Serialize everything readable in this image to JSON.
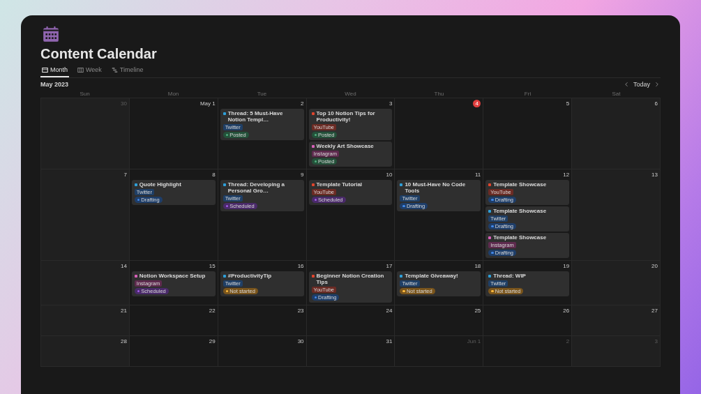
{
  "app": {
    "title": "Content Calendar"
  },
  "views": [
    {
      "label": "Month",
      "selected": true
    },
    {
      "label": "Week",
      "selected": false
    },
    {
      "label": "Timeline",
      "selected": false
    }
  ],
  "header": {
    "month": "May 2023",
    "today_button": "Today"
  },
  "weekdays": [
    "Sun",
    "Mon",
    "Tue",
    "Wed",
    "Thu",
    "Fri",
    "Sat"
  ],
  "weeks": [
    {
      "days": [
        {
          "date": "30",
          "in_month": false,
          "today": false
        },
        {
          "date": "May 1",
          "in_month": true,
          "today": false
        },
        {
          "date": "2",
          "in_month": true,
          "today": false,
          "events": [
            {
              "title": "Thread: 5 Must-Have Notion Templ…",
              "color": "#2e9fd8",
              "platform": {
                "label": "Twitter",
                "color": "#1f3f66"
              },
              "status": {
                "label": "Posted",
                "color": "#24513a"
              }
            }
          ]
        },
        {
          "date": "3",
          "in_month": true,
          "today": false,
          "events": [
            {
              "title": "Top 10 Notion Tips for Productivity!",
              "color": "#e0442c",
              "platform": {
                "label": "YouTube",
                "color": "#6b2b24"
              },
              "status": {
                "label": "Posted",
                "color": "#24513a"
              }
            },
            {
              "title": "Weekly Art Showcase",
              "color": "#d660b8",
              "platform": {
                "label": "Instagram",
                "color": "#5e2a4e"
              },
              "status": {
                "label": "Posted",
                "color": "#24513a"
              }
            }
          ]
        },
        {
          "date": "4",
          "in_month": true,
          "today": true
        },
        {
          "date": "5",
          "in_month": true,
          "today": false
        },
        {
          "date": "6",
          "in_month": true,
          "today": false
        }
      ]
    },
    {
      "days": [
        {
          "date": "7",
          "in_month": true,
          "today": false
        },
        {
          "date": "8",
          "in_month": true,
          "today": false,
          "events": [
            {
              "title": "Quote Highlight",
              "color": "#2e9fd8",
              "platform": {
                "label": "Twitter",
                "color": "#1f3f66"
              },
              "status": {
                "label": "Drafting",
                "color": "#1e3e6a"
              }
            }
          ]
        },
        {
          "date": "9",
          "in_month": true,
          "today": false,
          "events": [
            {
              "title": "Thread: Developing a Personal Gro…",
              "color": "#2e9fd8",
              "platform": {
                "label": "Twitter",
                "color": "#1f3f66"
              },
              "status": {
                "label": "Scheduled",
                "color": "#4a2a6a"
              }
            }
          ]
        },
        {
          "date": "10",
          "in_month": true,
          "today": false,
          "events": [
            {
              "title": "Template Tutorial",
              "color": "#e0442c",
              "platform": {
                "label": "YouTube",
                "color": "#6b2b24"
              },
              "status": {
                "label": "Scheduled",
                "color": "#4a2a6a"
              }
            }
          ]
        },
        {
          "date": "11",
          "in_month": true,
          "today": false,
          "events": [
            {
              "title": "10 Must-Have No Code Tools",
              "color": "#2e9fd8",
              "platform": {
                "label": "Twitter",
                "color": "#1f3f66"
              },
              "status": {
                "label": "Drafting",
                "color": "#1e3e6a"
              }
            }
          ]
        },
        {
          "date": "12",
          "in_month": true,
          "today": false,
          "events": [
            {
              "title": "Template Showcase",
              "color": "#e0442c",
              "platform": {
                "label": "YouTube",
                "color": "#6b2b24"
              },
              "status": {
                "label": "Drafting",
                "color": "#1e3e6a"
              }
            },
            {
              "title": "Template Showcase",
              "color": "#2e9fd8",
              "platform": {
                "label": "Twitter",
                "color": "#1f3f66"
              },
              "status": {
                "label": "Drafting",
                "color": "#1e3e6a"
              }
            },
            {
              "title": "Template Showcase",
              "color": "#d660b8",
              "platform": {
                "label": "Instagram",
                "color": "#5e2a4e"
              },
              "status": {
                "label": "Drafting",
                "color": "#1e3e6a"
              }
            }
          ]
        },
        {
          "date": "13",
          "in_month": true,
          "today": false
        }
      ]
    },
    {
      "days": [
        {
          "date": "14",
          "in_month": true,
          "today": false
        },
        {
          "date": "15",
          "in_month": true,
          "today": false,
          "events": [
            {
              "title": "Notion Workspace Setup",
              "color": "#d660b8",
              "platform": {
                "label": "Instagram",
                "color": "#5e2a4e"
              },
              "status": {
                "label": "Scheduled",
                "color": "#4a2a6a"
              }
            }
          ]
        },
        {
          "date": "16",
          "in_month": true,
          "today": false,
          "events": [
            {
              "title": "#ProductivityTip",
              "color": "#2e9fd8",
              "platform": {
                "label": "Twitter",
                "color": "#1f3f66"
              },
              "status": {
                "label": "Not started",
                "color": "#7a551c"
              }
            }
          ]
        },
        {
          "date": "17",
          "in_month": true,
          "today": false,
          "events": [
            {
              "title": "Beginner Notion Creation Tips",
              "color": "#e0442c",
              "platform": {
                "label": "YouTube",
                "color": "#6b2b24"
              },
              "status": {
                "label": "Drafting",
                "color": "#1e3e6a"
              }
            }
          ]
        },
        {
          "date": "18",
          "in_month": true,
          "today": false,
          "events": [
            {
              "title": "Template Giveaway!",
              "color": "#2e9fd8",
              "platform": {
                "label": "Twitter",
                "color": "#1f3f66"
              },
              "status": {
                "label": "Not started",
                "color": "#7a551c"
              }
            }
          ]
        },
        {
          "date": "19",
          "in_month": true,
          "today": false,
          "events": [
            {
              "title": "Thread: WIP",
              "color": "#2e9fd8",
              "platform": {
                "label": "Twitter",
                "color": "#1f3f66"
              },
              "status": {
                "label": "Not started",
                "color": "#7a551c"
              }
            }
          ]
        },
        {
          "date": "20",
          "in_month": true,
          "today": false
        }
      ]
    },
    {
      "days": [
        {
          "date": "21",
          "in_month": true,
          "today": false
        },
        {
          "date": "22",
          "in_month": true,
          "today": false
        },
        {
          "date": "23",
          "in_month": true,
          "today": false
        },
        {
          "date": "24",
          "in_month": true,
          "today": false
        },
        {
          "date": "25",
          "in_month": true,
          "today": false
        },
        {
          "date": "26",
          "in_month": true,
          "today": false
        },
        {
          "date": "27",
          "in_month": true,
          "today": false
        }
      ]
    },
    {
      "days": [
        {
          "date": "28",
          "in_month": true,
          "today": false
        },
        {
          "date": "29",
          "in_month": true,
          "today": false
        },
        {
          "date": "30",
          "in_month": true,
          "today": false
        },
        {
          "date": "31",
          "in_month": true,
          "today": false
        },
        {
          "date": "Jun 1",
          "in_month": false,
          "today": false
        },
        {
          "date": "2",
          "in_month": false,
          "today": false
        },
        {
          "date": "3",
          "in_month": false,
          "today": false
        }
      ]
    }
  ]
}
